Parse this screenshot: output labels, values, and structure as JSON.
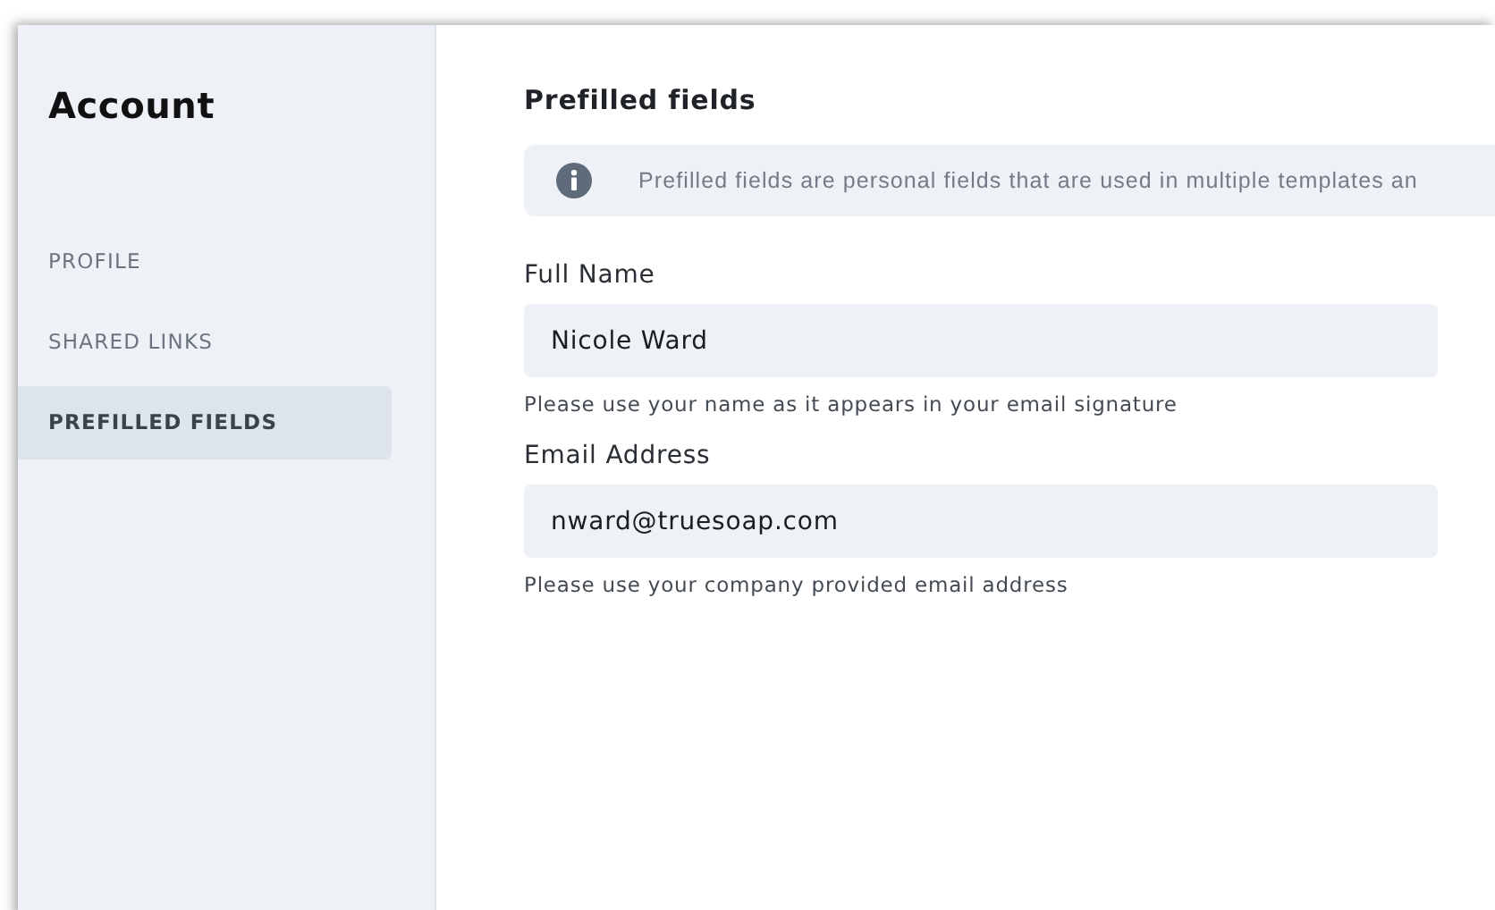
{
  "sidebar": {
    "title": "Account",
    "items": [
      {
        "label": "PROFILE",
        "selected": false
      },
      {
        "label": "SHARED LINKS",
        "selected": false
      },
      {
        "label": "PREFILLED FIELDS",
        "selected": true
      }
    ]
  },
  "main": {
    "heading": "Prefilled fields",
    "info": "Prefilled fields are personal fields that are used in multiple templates an",
    "fields": [
      {
        "label": "Full Name",
        "value": "Nicole Ward",
        "hint": "Please use your name as it appears in your email signature"
      },
      {
        "label": "Email Address",
        "value": "nward@truesoap.com",
        "hint": "Please use your company provided email address"
      }
    ]
  }
}
